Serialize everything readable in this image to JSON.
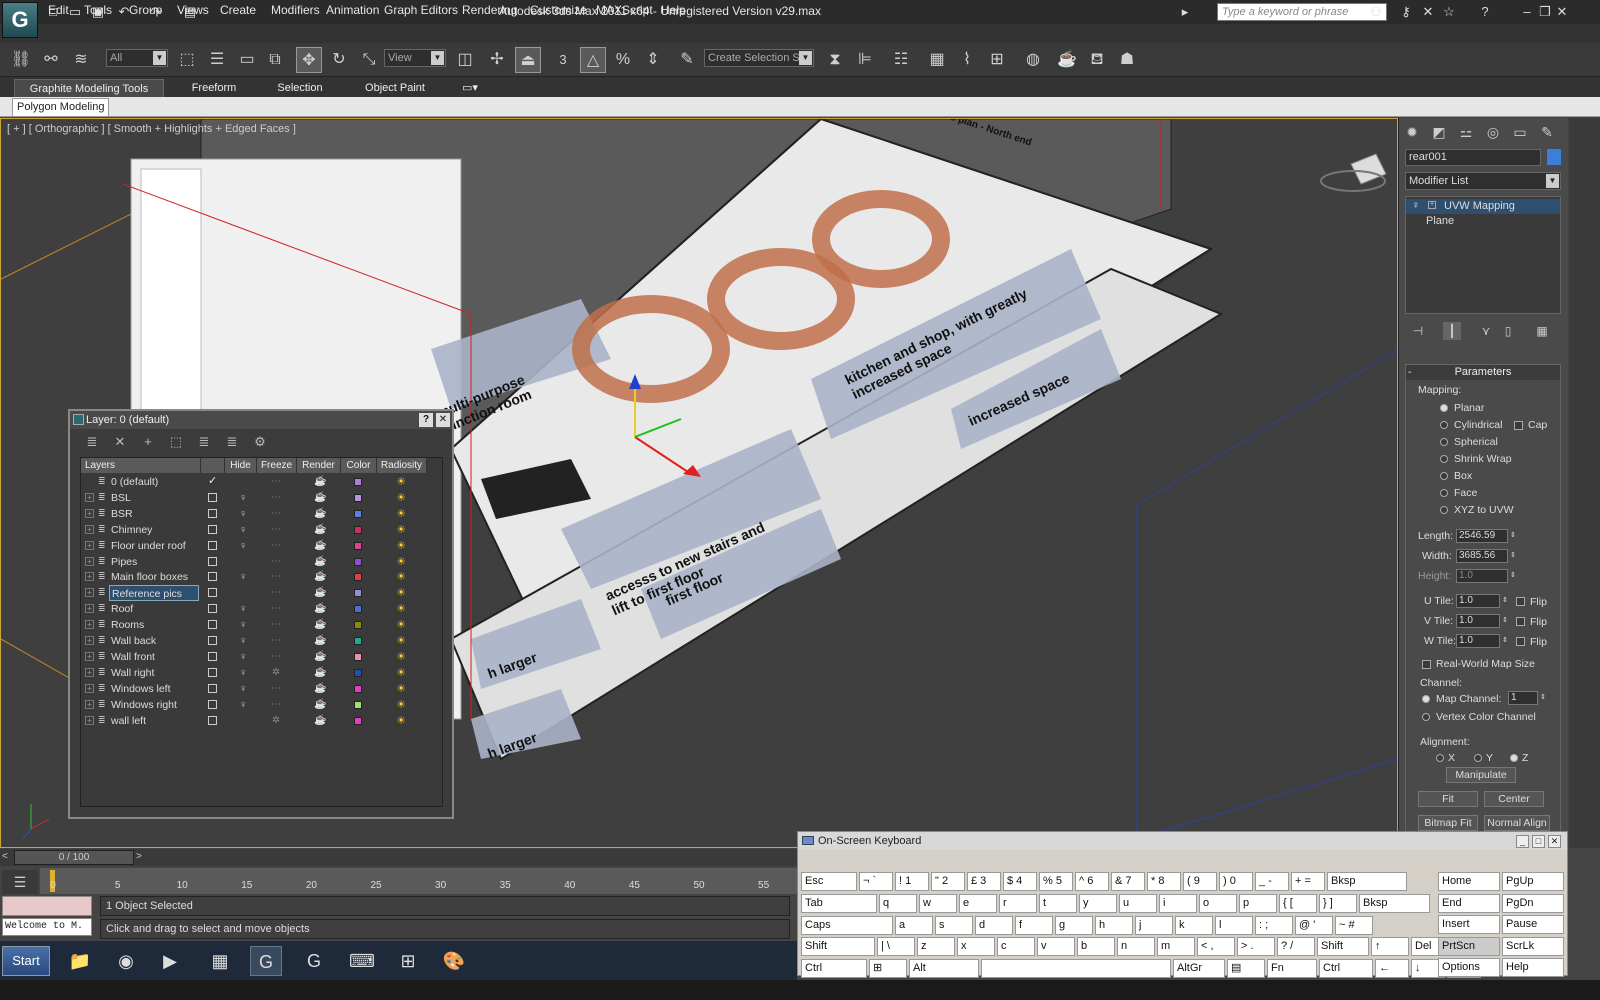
{
  "app": {
    "title": "Autodesk 3ds Max  2011 x64  - Unregistered Version   v29.max",
    "logo_glyph": "G",
    "search_placeholder": "Type a keyword or phrase"
  },
  "menu": [
    "Edit",
    "Tools",
    "Group",
    "Views",
    "Create",
    "Modifiers",
    "Animation",
    "Graph Editors",
    "Rendering",
    "Customize",
    "MAXScript",
    "Help"
  ],
  "toolbar": {
    "selection_filter": "All",
    "ref_coord": "View",
    "named_sel_set": "Create Selection Se",
    "snap_label": "3"
  },
  "ribbon": {
    "tabs": [
      "Graphite Modeling Tools",
      "Freeform",
      "Selection",
      "Object Paint"
    ],
    "sub_tab": "Polygon Modeling"
  },
  "viewport": {
    "label": "[ + ] [ Orthographic ] [ Smooth + Highlights + Edged Faces ]",
    "plan_texts": [
      "multi-purpose function room",
      "accesss to new stairs and lift to first floor",
      "kitchen and shop, with greatly increased space",
      "increased space",
      "first floor",
      "h larger",
      "h larger",
      "ct's plan - North end"
    ]
  },
  "layer_dialog": {
    "title": "Layer: 0 (default)",
    "help": "?",
    "close": "✕",
    "columns": [
      "Layers",
      "Hide",
      "Freeze",
      "Render",
      "Color",
      "Radiosity"
    ],
    "rows": [
      {
        "name": "0 (default)",
        "color": "#b07cd8",
        "checked": true
      },
      {
        "name": "BSL",
        "color": "#c090e0"
      },
      {
        "name": "BSR",
        "color": "#5a7fe0"
      },
      {
        "name": "Chimney",
        "color": "#c83060"
      },
      {
        "name": "Floor under roof",
        "color": "#e04090"
      },
      {
        "name": "Pipes",
        "color": "#8a50d0"
      },
      {
        "name": "Main floor boxes",
        "color": "#e04040"
      },
      {
        "name": "Reference pics",
        "color": "#9090d8"
      },
      {
        "name": "Roof",
        "color": "#4a70d0"
      },
      {
        "name": "Rooms",
        "color": "#8a8a10"
      },
      {
        "name": "Wall back",
        "color": "#20a890"
      },
      {
        "name": "Wall front",
        "color": "#e890b0"
      },
      {
        "name": "Wall right",
        "color": "#2050b0"
      },
      {
        "name": "Windows left",
        "color": "#e040c0"
      },
      {
        "name": "Windows right",
        "color": "#a0e070"
      },
      {
        "name": "wall left",
        "color": "#e040c0"
      }
    ]
  },
  "command_panel": {
    "object_name": "rear001",
    "modifier_list": "Modifier List",
    "stack": [
      "UVW Mapping",
      "Plane"
    ],
    "params_title": "Parameters",
    "mapping_label": "Mapping:",
    "mapping_options": [
      "Planar",
      "Cylindrical",
      "Spherical",
      "Shrink Wrap",
      "Box",
      "Face",
      "XYZ to UVW"
    ],
    "cap_label": "Cap",
    "length_label": "Length:",
    "length": "2546.59",
    "width_label": "Width:",
    "width": "3685.56",
    "height_label": "Height:",
    "height": "1.0",
    "utile_label": "U Tile:",
    "utile": "1.0",
    "vtile_label": "V Tile:",
    "vtile": "1.0",
    "wtile_label": "W Tile:",
    "wtile": "1.0",
    "flip_label": "Flip",
    "real_world": "Real-World Map Size",
    "channel_label": "Channel:",
    "map_channel": "Map Channel:",
    "map_channel_value": "1",
    "vertex_color": "Vertex Color Channel",
    "alignment_label": "Alignment:",
    "align_x": "X",
    "align_y": "Y",
    "align_z": "Z",
    "manipulate": "Manipulate",
    "fit": "Fit",
    "center": "Center",
    "bitmap_fit": "Bitmap Fit",
    "normal_align": "Normal Align"
  },
  "timeline": {
    "slider": "0 / 100",
    "ticks": [
      "0",
      "5",
      "10",
      "15",
      "20",
      "25",
      "30",
      "35",
      "40",
      "45",
      "50",
      "55"
    ]
  },
  "status": {
    "listener": "Welcome to M.",
    "selected": "1 Object Selected",
    "prompt": "Click and drag to select and move objects"
  },
  "osk": {
    "title": "On-Screen Keyboard",
    "row1": [
      "Esc",
      "¬ `",
      "! 1",
      "\" 2",
      "£ 3",
      "$ 4",
      "% 5",
      "^ 6",
      "& 7",
      "* 8",
      "( 9",
      ") 0",
      "_ -",
      "+ =",
      "Bksp"
    ],
    "row2": [
      "Tab",
      "q",
      "w",
      "e",
      "r",
      "t",
      "y",
      "u",
      "i",
      "o",
      "p",
      "{ [",
      "} ]"
    ],
    "row3": [
      "Caps",
      "a",
      "s",
      "d",
      "f",
      "g",
      "h",
      "j",
      "k",
      "l",
      ": ;",
      "@ '",
      "~ #"
    ],
    "row4": [
      "Shift",
      "| \\",
      "z",
      "x",
      "c",
      "v",
      "b",
      "n",
      "m",
      "< ,",
      "> .",
      "? /",
      "Shift",
      "↑",
      "Del"
    ],
    "row5": [
      "Ctrl",
      "⊞",
      "Alt",
      "",
      "AltGr",
      "▤",
      "Fn",
      "Ctrl",
      "←",
      "↓",
      "→"
    ],
    "side": [
      [
        "Home",
        "PgUp"
      ],
      [
        "End",
        "PgDn"
      ],
      [
        "Insert",
        "Pause"
      ],
      [
        "PrtScn",
        "ScrLk"
      ],
      [
        "Options",
        "Help"
      ]
    ]
  },
  "taskbar": {
    "start": "Start"
  }
}
